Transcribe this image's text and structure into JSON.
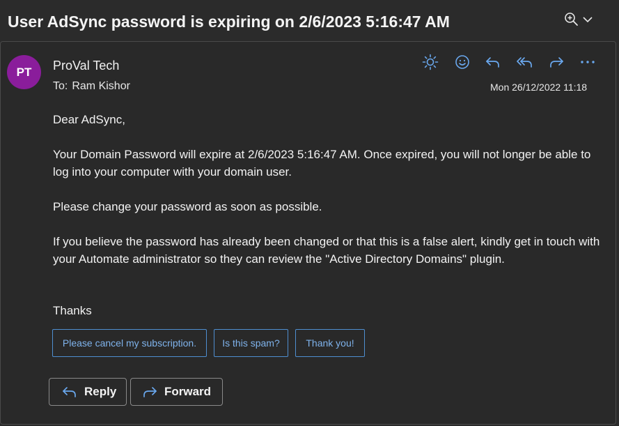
{
  "subject": "User AdSync password is expiring on 2/6/2023 5:16:47 AM",
  "header_controls": {
    "zoom_icon": "zoom-in-icon",
    "expand_icon": "chevron-down-icon"
  },
  "message": {
    "avatar_initials": "PT",
    "avatar_color": "#8a1d9b",
    "sender": "ProVal Tech",
    "to_label": "To:",
    "to_name": "Ram Kishor",
    "date": "Mon 26/12/2022 11:18",
    "actions": [
      {
        "name": "sun-icon",
        "label": "Switch background"
      },
      {
        "name": "smiley-icon",
        "label": "React"
      },
      {
        "name": "reply-icon",
        "label": "Reply"
      },
      {
        "name": "reply-all-icon",
        "label": "Reply all"
      },
      {
        "name": "forward-icon",
        "label": "Forward"
      },
      {
        "name": "more-icon",
        "label": "More actions"
      }
    ],
    "body": {
      "greeting": "Dear AdSync,",
      "paragraph1": "Your Domain Password will expire at 2/6/2023 5:16:47 AM. Once expired, you will not longer be able to log into your computer with your domain user.",
      "paragraph2": "Please change your password as soon as possible.",
      "paragraph3": "If you believe the password has already been changed or that this is a false alert, kindly get in touch with your Automate administrator so they can review the \"Active Directory Domains\" plugin.",
      "closing": "Thanks"
    },
    "suggested_replies": [
      "Please cancel my subscription.",
      "Is this spam?",
      "Thank you!"
    ],
    "reply_button": "Reply",
    "forward_button": "Forward"
  },
  "colors": {
    "accent": "#4f8fd1",
    "icon_blue": "#6aa8ee",
    "background": "#292929"
  }
}
